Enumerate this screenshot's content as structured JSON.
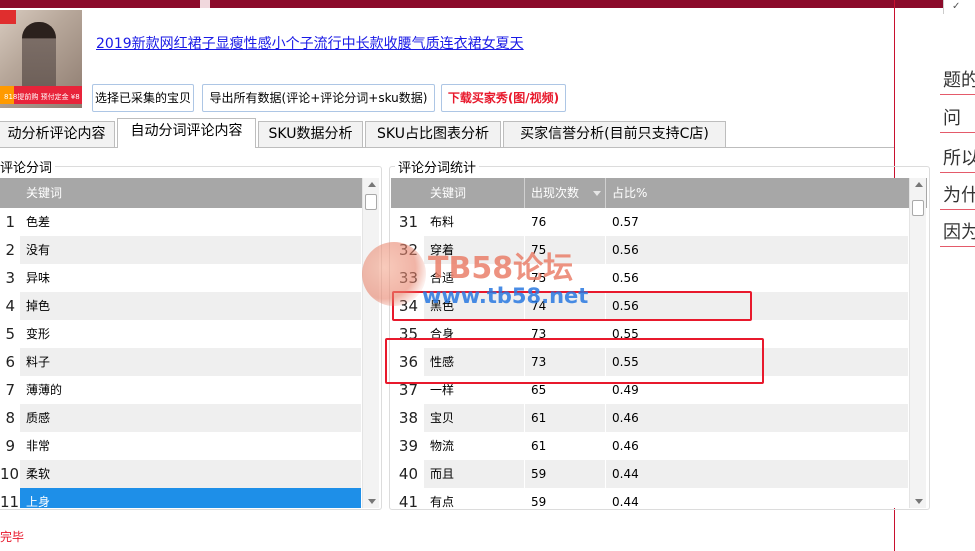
{
  "product": {
    "title": "2019新款网红裙子显瘦性感小个子流行中长款收腰气质连衣裙女夏天",
    "thumb_band_text": "818提前购 预付定金 ¥8 立减5元"
  },
  "buttons": {
    "select_collected": "选择已采集的宝贝",
    "export_all": "导出所有数据(评论+评论分词+sku数据)",
    "download_buyer_show": "下载买家秀(图/视频)"
  },
  "tabs": [
    {
      "label": "动分析评论内容"
    },
    {
      "label": "自动分词评论内容"
    },
    {
      "label": "SKU数据分析"
    },
    {
      "label": "SKU占比图表分析"
    },
    {
      "label": "买家信誉分析(目前只支持C店)"
    }
  ],
  "left_panel": {
    "title": "评论分词",
    "header": {
      "keyword": "关键词"
    },
    "rows": [
      {
        "n": "1",
        "kw": "色差"
      },
      {
        "n": "2",
        "kw": "没有"
      },
      {
        "n": "3",
        "kw": "异味"
      },
      {
        "n": "4",
        "kw": "掉色"
      },
      {
        "n": "5",
        "kw": "变形"
      },
      {
        "n": "6",
        "kw": "料子"
      },
      {
        "n": "7",
        "kw": "薄薄的"
      },
      {
        "n": "8",
        "kw": "质感"
      },
      {
        "n": "9",
        "kw": "非常"
      },
      {
        "n": "10",
        "kw": "柔软"
      },
      {
        "n": "11",
        "kw": "上身"
      }
    ]
  },
  "right_panel": {
    "title": "评论分词统计",
    "header": {
      "keyword": "关键词",
      "count": "出现次数",
      "ratio": "占比%"
    },
    "rows": [
      {
        "n": "31",
        "kw": "布料",
        "count": "76",
        "ratio": "0.57"
      },
      {
        "n": "32",
        "kw": "穿着",
        "count": "75",
        "ratio": "0.56"
      },
      {
        "n": "33",
        "kw": "合适",
        "count": "75",
        "ratio": "0.56"
      },
      {
        "n": "34",
        "kw": "黑色",
        "count": "74",
        "ratio": "0.56"
      },
      {
        "n": "35",
        "kw": "合身",
        "count": "73",
        "ratio": "0.55"
      },
      {
        "n": "36",
        "kw": "性感",
        "count": "73",
        "ratio": "0.55"
      },
      {
        "n": "37",
        "kw": "一样",
        "count": "65",
        "ratio": "0.49"
      },
      {
        "n": "38",
        "kw": "宝贝",
        "count": "61",
        "ratio": "0.46"
      },
      {
        "n": "39",
        "kw": "物流",
        "count": "61",
        "ratio": "0.46"
      },
      {
        "n": "40",
        "kw": "而且",
        "count": "59",
        "ratio": "0.44"
      },
      {
        "n": "41",
        "kw": "有点",
        "count": "59",
        "ratio": "0.44"
      }
    ]
  },
  "watermark": {
    "brand": "TB58论坛",
    "site": "www.tb58.net"
  },
  "status": "完毕",
  "right_fragments": [
    "题的",
    "问",
    "所以",
    "为什",
    "因为"
  ],
  "right_checkmark": "✓",
  "colors": {
    "accent": "#8b0a2a",
    "highlight": "#e8192c",
    "selection": "#1e8fe8",
    "link": "#1a1ae6"
  }
}
